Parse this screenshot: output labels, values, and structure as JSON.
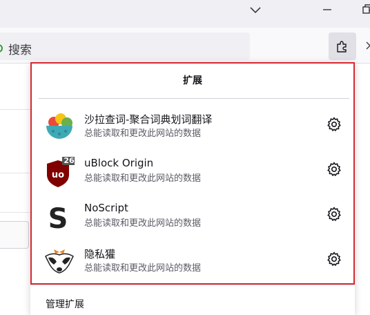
{
  "toolbar": {
    "urlbar_placeholder": "搜索"
  },
  "panel": {
    "title": "扩展",
    "manage_label": "管理扩展",
    "items": [
      {
        "name": "沙拉查词-聚合词典划词翻译",
        "desc": "总能读取和更改此网站的数据",
        "icon": "saladict-icon"
      },
      {
        "name": "uBlock Origin",
        "desc": "总能读取和更改此网站的数据",
        "icon": "ublock-icon",
        "badge": "26"
      },
      {
        "name": "NoScript",
        "desc": "总能读取和更改此网站的数据",
        "icon": "noscript-icon"
      },
      {
        "name": "隐私獾",
        "desc": "总能读取和更改此网站的数据",
        "icon": "privacy-badger-icon"
      }
    ]
  },
  "colors": {
    "highlight": "#d9262f",
    "ublock_red": "#800000",
    "badge_bg": "#555555"
  }
}
